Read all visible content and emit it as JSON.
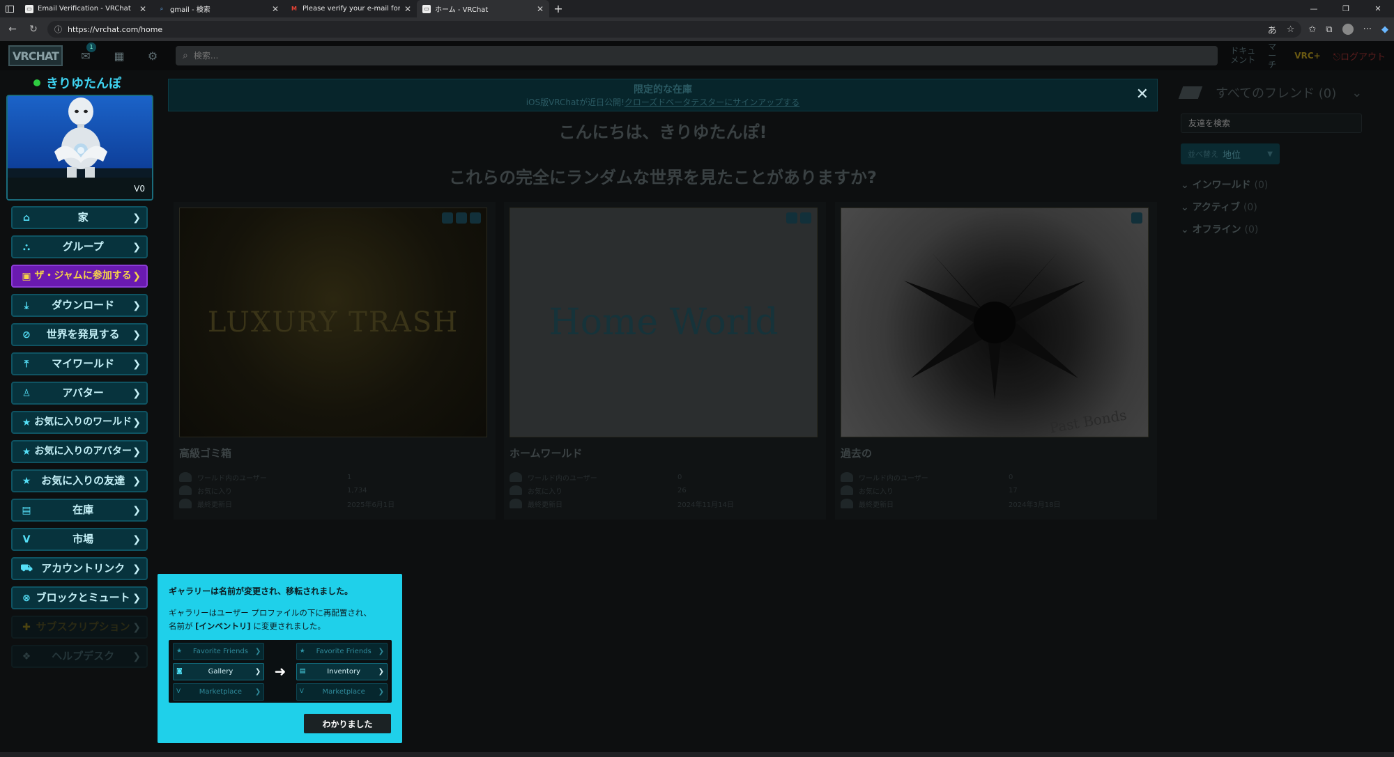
{
  "browser": {
    "tabs": [
      {
        "title": "Email Verification - VRChat",
        "favicon": "vrchat-icon"
      },
      {
        "title": "gmail - 検索",
        "favicon": "search-icon"
      },
      {
        "title": "Please verify your e-mail for VRC",
        "favicon": "gmail-icon"
      },
      {
        "title": "ホーム - VRChat",
        "favicon": "vrchat-icon"
      }
    ],
    "url": "https://vrchat.com/home"
  },
  "header": {
    "logo": "VRCHAT",
    "notification_count": "1",
    "search_placeholder": "検索...",
    "docs": "ドキュメント",
    "march": "マーチ",
    "vrc_plus": "VRC+",
    "logout": "ログアウト"
  },
  "profile": {
    "name": "きりゆたんぽ",
    "credits": "V0"
  },
  "nav": [
    {
      "label": "家",
      "icon": "home-icon"
    },
    {
      "label": "グループ",
      "icon": "group-icon"
    },
    {
      "label": "ザ・ジャムに参加する",
      "icon": "jam-icon"
    },
    {
      "label": "ダウンロード",
      "icon": "download-icon"
    },
    {
      "label": "世界を発見する",
      "icon": "compass-icon"
    },
    {
      "label": "マイワールド",
      "icon": "upload-icon"
    },
    {
      "label": "アバター",
      "icon": "avatar-icon"
    },
    {
      "label": "お気に入りのワールド",
      "icon": "star-icon"
    },
    {
      "label": "お気に入りのアバター",
      "icon": "star-icon"
    },
    {
      "label": "お気に入りの友達",
      "icon": "star-icon"
    },
    {
      "label": "在庫",
      "icon": "inventory-icon"
    },
    {
      "label": "市場",
      "icon": "marketplace-icon"
    },
    {
      "label": "アカウントリンク",
      "icon": "link-icon"
    },
    {
      "label": "ブロックとミュート",
      "icon": "block-icon"
    },
    {
      "label": "サブスクリプション",
      "icon": "subscription-icon"
    },
    {
      "label": "ヘルプデスク",
      "icon": "help-icon"
    }
  ],
  "promo": {
    "title": "限定的な在庫",
    "text_prefix": "iOS版VRChatが近日公開!",
    "link": "クローズドベータテスターにサインアップする"
  },
  "greeting": "こんにちは、きりゆたんぽ!",
  "question": "これらの完全にランダムな世界を見たことがありますか?",
  "worlds": [
    {
      "name": "高級ゴミ箱",
      "thumb_text": "LUXURY TRASH",
      "users": "1",
      "favorites": "1,734",
      "updated": "2025年6月1日"
    },
    {
      "name": "ホームワールド",
      "thumb_text": "Home World",
      "users": "0",
      "favorites": "26",
      "updated": "2024年11月14日"
    },
    {
      "name": "過去の",
      "thumb_text": "Past Bonds",
      "users": "0",
      "favorites": "17",
      "updated": "2024年3月18日"
    }
  ],
  "stat_labels": {
    "users": "ワールド内のユーザー",
    "favorites": "お気に入り",
    "updated": "最終更新日"
  },
  "friends": {
    "title": "すべてのフレンド (0)",
    "search_placeholder": "友達を検索",
    "sort_label": "並べ替え",
    "sort_value": "地位",
    "groups": [
      {
        "label": "インワールド",
        "count": "(0)"
      },
      {
        "label": "アクティブ",
        "count": "(0)"
      },
      {
        "label": "オフライン",
        "count": "(0)"
      }
    ]
  },
  "notice": {
    "title": "ギャラリーは名前が変更され、移転されました。",
    "body_line1": "ギャラリーはユーザー プロファイルの下に再配置され、",
    "body_line2_prefix": "名前が",
    "body_line2_bold": "[インベントリ]",
    "body_line2_suffix": "に変更されました。",
    "before": [
      "Favorite Friends",
      "Gallery",
      "Marketplace"
    ],
    "after": [
      "Favorite Friends",
      "Inventory",
      "Marketplace"
    ],
    "button": "わかりました"
  },
  "colors": {
    "accent": "#1fd0ea",
    "jam_bg": "#6a1ab0",
    "jam_text": "#f6d548",
    "online": "#2ecc40"
  }
}
